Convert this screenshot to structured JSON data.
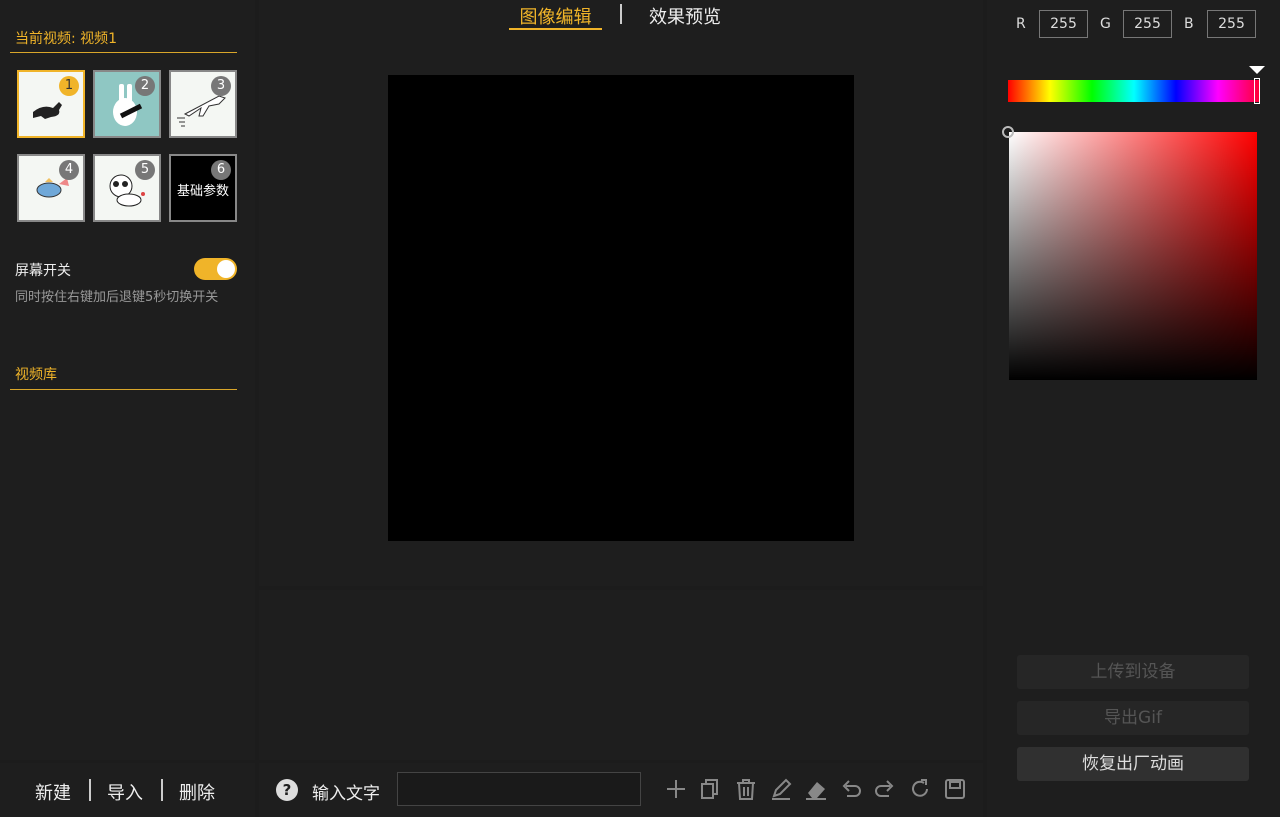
{
  "tabs": {
    "edit": "图像编辑",
    "preview": "效果预览"
  },
  "left": {
    "current_video": "当前视频: 视频1",
    "thumbs": [
      {
        "num": "1",
        "label": ""
      },
      {
        "num": "2",
        "label": ""
      },
      {
        "num": "3",
        "label": ""
      },
      {
        "num": "4",
        "label": ""
      },
      {
        "num": "5",
        "label": ""
      },
      {
        "num": "6",
        "label": "基础参数"
      }
    ],
    "screen_switch": "屏幕开关",
    "screen_switch_on": true,
    "screen_hint": "同时按住右键加后退键5秒切换开关",
    "library": "视频库"
  },
  "left_bar": {
    "new": "新建",
    "import": "导入",
    "delete": "删除"
  },
  "bottom": {
    "input_label": "输入文字",
    "input_value": "",
    "input_placeholder": ""
  },
  "right": {
    "r_label": "R",
    "g_label": "G",
    "b_label": "B",
    "r": "255",
    "g": "255",
    "b": "255",
    "upload": "上传到设备",
    "export_gif": "导出Gif",
    "restore": "恢复出厂动画"
  },
  "colors": {
    "accent": "#f0b429",
    "canvas": "#000000"
  },
  "icons": [
    "help-icon",
    "add-icon",
    "copy-icon",
    "trash-icon",
    "pencil-icon",
    "eraser-icon",
    "undo-icon",
    "redo-icon",
    "rotate-icon",
    "save-icon"
  ]
}
